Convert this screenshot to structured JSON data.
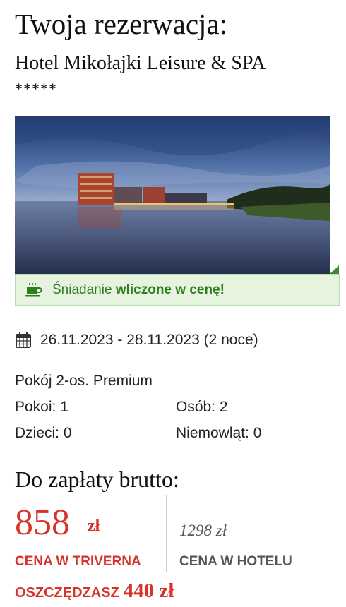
{
  "header": {
    "title": "Twoja rezerwacja:",
    "hotel_name": "Hotel Mikołajki Leisure & SPA",
    "stars": "*****"
  },
  "breakfast": {
    "prefix": "Śniadanie",
    "highlight": "wliczone w cenę!",
    "icon": "coffee-cup-icon"
  },
  "stay": {
    "dates": "26.11.2023 - 28.11.2023 (2 noce)",
    "icon": "calendar-icon",
    "room_type": "Pokój 2-os. Premium",
    "rooms": "Pokoi: 1",
    "persons": "Osób: 2",
    "children": "Dzieci: 0",
    "infants": "Niemowląt: 0"
  },
  "payment": {
    "title": "Do zapłaty brutto:",
    "price": "858",
    "currency": "zł",
    "price_label": "CENA W TRIVERNA",
    "hotel_price": "1298 zł",
    "hotel_price_label": "CENA W HOTELU",
    "savings_label": "OSZCZĘDZASZ",
    "savings_amount": "440 zł"
  },
  "colors": {
    "accent_red": "#d7332c",
    "breakfast_green": "#2e7d1f",
    "breakfast_bg": "#e5f3df"
  }
}
